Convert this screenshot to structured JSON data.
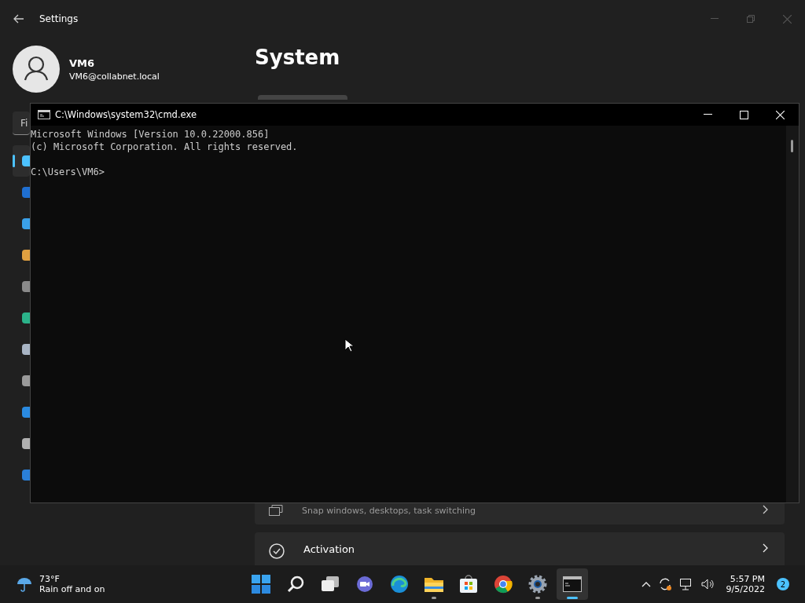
{
  "settings_window": {
    "title": "Settings",
    "user": {
      "name": "VM6",
      "email": "VM6@collabnet.local"
    },
    "search": {
      "value": "Fi"
    },
    "nav": [
      {
        "selected": true,
        "color": "#4cc2ff"
      },
      {
        "selected": false,
        "color": "#1f6fd1"
      },
      {
        "selected": false,
        "color": "#3aa0e8"
      },
      {
        "selected": false,
        "color": "#e0a040"
      },
      {
        "selected": false,
        "color": "#8a8a8a"
      },
      {
        "selected": false,
        "color": "#2bb38a"
      },
      {
        "selected": false,
        "color": "#a8b4c4"
      },
      {
        "selected": false,
        "color": "#9a9a9a"
      },
      {
        "selected": false,
        "color": "#2a8ae0"
      },
      {
        "selected": false,
        "color": "#b0b0b0"
      },
      {
        "selected": false,
        "color": "#2a7fd8"
      }
    ],
    "page_title": "System",
    "cards": [
      {
        "kind": "multitasking",
        "subtitle": "Snap windows, desktops, task switching"
      },
      {
        "kind": "activation",
        "title": "Activation"
      }
    ]
  },
  "cmd_window": {
    "title": "C:\\Windows\\system32\\cmd.exe",
    "blocks": [
      [
        "Microsoft Windows [Version 10.0.22000.856]",
        "(c) Microsoft Corporation. All rights reserved."
      ],
      [
        "C:\\Users\\VM6>"
      ]
    ]
  },
  "taskbar": {
    "weather": {
      "temp": "73°F",
      "condition": "Rain off and on"
    },
    "apps": [
      {
        "kind": "start",
        "running": false,
        "selected": false
      },
      {
        "kind": "search",
        "running": false,
        "selected": false
      },
      {
        "kind": "taskview",
        "running": false,
        "selected": false
      },
      {
        "kind": "chat",
        "running": false,
        "selected": false
      },
      {
        "kind": "edge",
        "running": false,
        "selected": false
      },
      {
        "kind": "explorer",
        "running": true,
        "selected": false
      },
      {
        "kind": "store",
        "running": false,
        "selected": false
      },
      {
        "kind": "chrome",
        "running": false,
        "selected": false
      },
      {
        "kind": "settings",
        "running": true,
        "selected": false
      },
      {
        "kind": "terminal",
        "running": true,
        "selected": true
      }
    ],
    "time": "5:57 PM",
    "date": "9/5/2022",
    "notifications": "2"
  }
}
